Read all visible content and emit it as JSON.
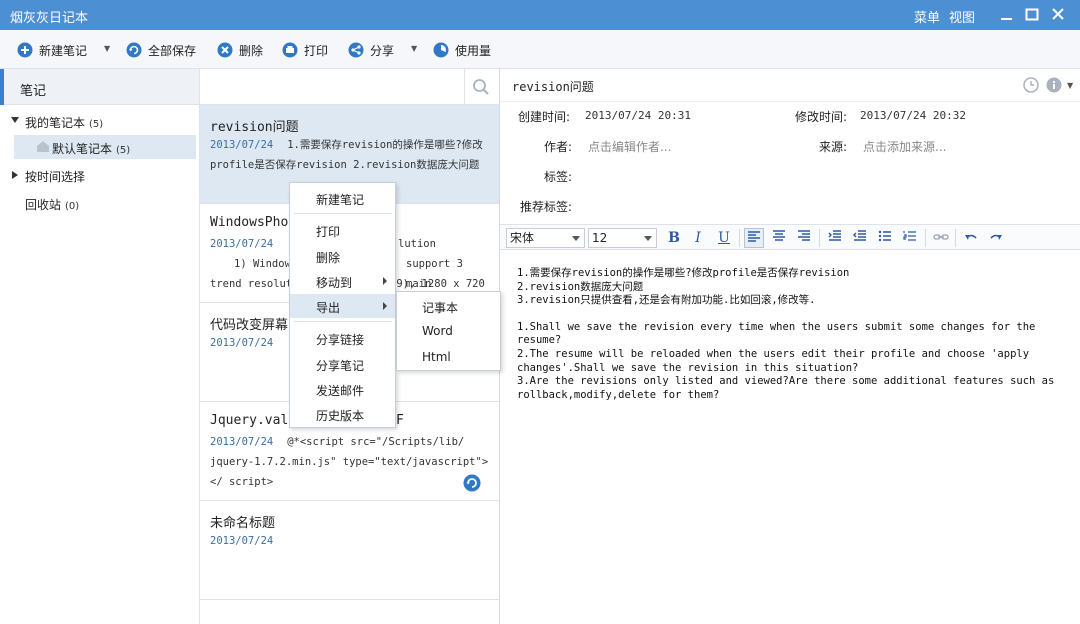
{
  "window": {
    "title": "烟灰灰日记本",
    "menu_label": "菜单",
    "view_label": "视图"
  },
  "toolbar": {
    "new_note": "新建笔记",
    "save_all": "全部保存",
    "delete": "删除",
    "print": "打印",
    "share": "分享",
    "usage": "使用量"
  },
  "sidebar": {
    "header": "笔记",
    "my_notebooks": {
      "label": "我的笔记本",
      "count": "(5)"
    },
    "default_notebook": {
      "label": "默认笔记本",
      "count": "(5)"
    },
    "by_time": "按时间选择",
    "recycle": {
      "label": "回收站",
      "count": "(0)"
    }
  },
  "search": {
    "placeholder": ""
  },
  "notes": [
    {
      "title": "revision问题",
      "date": "2013/07/24",
      "snippet": "1.需要保存revision的操作是哪些?修改profile是否保存revision 2.revision数据庞大问题"
    },
    {
      "title": "WindowsPhone",
      "date": "2013/07/24",
      "snippet_right": "lution",
      "snippet_2": "1) Window",
      "snippet_2_right": "support 3 main",
      "snippet_3": "trend resolut",
      "snippet_3_right": ":9), 1280 x 720"
    },
    {
      "title": "代码改变屏幕",
      "date": "2013/07/24",
      "snippet": ""
    },
    {
      "title": "Jquery.vali",
      "title_right": "F",
      "date": "2013/07/24",
      "snippet": "@*<script src=\"/Scripts/lib/ jquery-1.7.2.min.js\" type=\"text/javascript\"></ script>"
    },
    {
      "title": "未命名标题",
      "date": "2013/07/24"
    }
  ],
  "editor": {
    "title": "revision问题",
    "created_label": "创建时间:",
    "created_value": "2013/07/24 20:31",
    "modified_label": "修改时间:",
    "modified_value": "2013/07/24 20:32",
    "author_label": "作者:",
    "author_placeholder": "点击编辑作者...",
    "source_label": "来源:",
    "source_placeholder": "点击添加来源...",
    "tags_label": "标签:",
    "rec_tags_label": "推荐标签:",
    "font_family": "宋体",
    "font_size": "12",
    "bold": "B",
    "italic": "I",
    "underline": "U",
    "content": [
      "1.需要保存revision的操作是哪些?修改profile是否保存revision",
      "2.revision数据庞大问题",
      "3.revision只提供查看,还是会有附加功能.比如回滚,修改等.",
      "",
      "1.Shall we save the revision every time when the users submit some changes for the resume?",
      "2.The resume will be reloaded when the users edit their profile and choose 'apply changes'.Shall we save the revision in this situation?",
      "3.Are the revisions only listed and viewed?Are there some additional features such as rollback,modify,delete for them?"
    ]
  },
  "context_menu": {
    "new_note": "新建笔记",
    "print": "打印",
    "delete": "删除",
    "move_to": "移动到",
    "export": "导出",
    "share_link": "分享链接",
    "share_note": "分享笔记",
    "send_mail": "发送邮件",
    "history": "历史版本"
  },
  "export_submenu": {
    "notepad": "记事本",
    "word": "Word",
    "html": "Html"
  },
  "colors": {
    "titlebar": "#4c8fd3",
    "accent": "#3a7fd0",
    "selection": "#dde8f3"
  }
}
